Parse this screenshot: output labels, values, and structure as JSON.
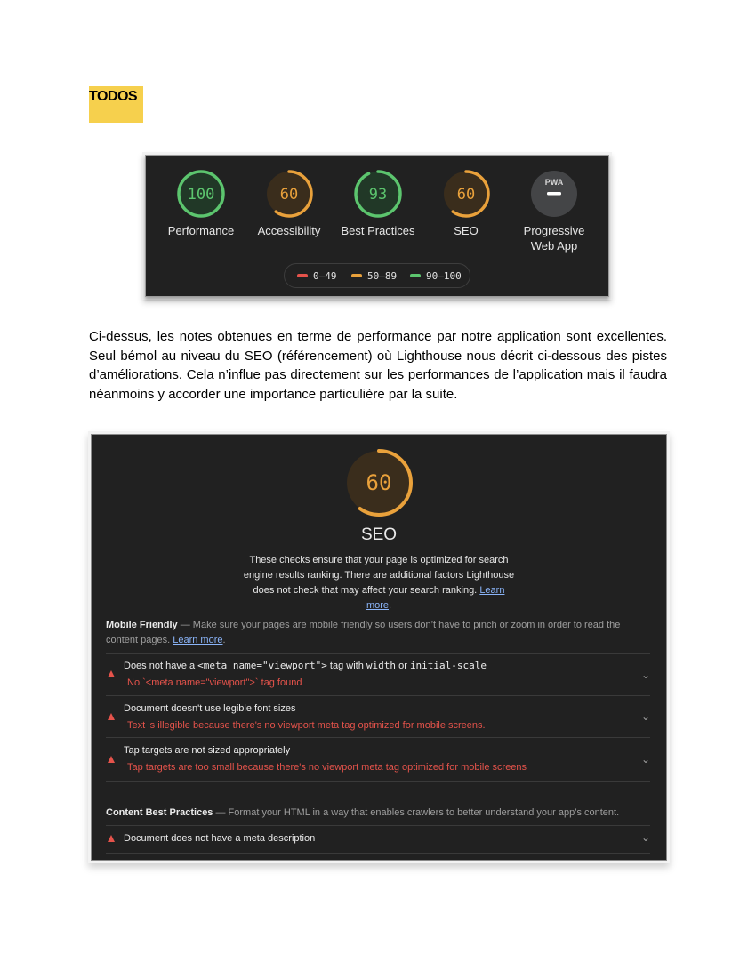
{
  "heading": "TODOS",
  "scores": [
    {
      "value": "100",
      "label": "Performance",
      "fraction": 1.0,
      "color": "#5cc56e"
    },
    {
      "value": "60",
      "label": "Accessibility",
      "fraction": 0.6,
      "color": "#e9a13b"
    },
    {
      "value": "93",
      "label": "Best Practices",
      "fraction": 0.93,
      "color": "#5cc56e"
    },
    {
      "value": "60",
      "label": "SEO",
      "fraction": 0.6,
      "color": "#e9a13b"
    }
  ],
  "pwa": {
    "badge": "PWA",
    "label_line1": "Progressive",
    "label_line2": "Web App"
  },
  "legend": {
    "fail": "0–49",
    "average": "50–89",
    "pass": "90–100"
  },
  "colors": {
    "fail": "#e5534b",
    "average": "#e9a13b",
    "pass": "#5cc56e"
  },
  "paragraph": "Ci-dessus, les notes obtenues en terme de performance par notre application sont excellentes. Seul bémol au niveau du SEO (référencement) où Lighthouse nous décrit ci-dessous des pistes d’améliorations. Cela n’influe pas directement sur les performances de l’application mais il faudra néanmoins y accorder une importance particulière par la suite.",
  "seo": {
    "score": "60",
    "fraction": 0.6,
    "title": "SEO",
    "description": "These checks ensure that your page is optimized for search engine results ranking. There are additional factors Lighthouse does not check that may affect your search ranking.",
    "learn_more": "Learn more",
    "mobile": {
      "title": "Mobile Friendly",
      "desc": " — Make sure your pages are mobile friendly so users don’t have to pinch or zoom in order to read the content pages.",
      "learn_more": "Learn more"
    },
    "audits": [
      {
        "title_pre": "Does not have a ",
        "code1": "<meta name=\"viewport\">",
        "title_mid": " tag with ",
        "code2": "width",
        "title_or": " or ",
        "code3": "initial-scale",
        "detail": "No `<meta name=\"viewport\">` tag found"
      },
      {
        "title": "Document doesn't use legible font sizes",
        "detail": "Text is illegible because there's no viewport meta tag optimized for mobile screens."
      },
      {
        "title": "Tap targets are not sized appropriately",
        "detail": "Tap targets are too small because there's no viewport meta tag optimized for mobile screens"
      }
    ],
    "content": {
      "title": "Content Best Practices",
      "desc": " — Format your HTML in a way that enables crawlers to better understand your app’s content."
    },
    "content_audit": "Document does not have a meta description"
  }
}
